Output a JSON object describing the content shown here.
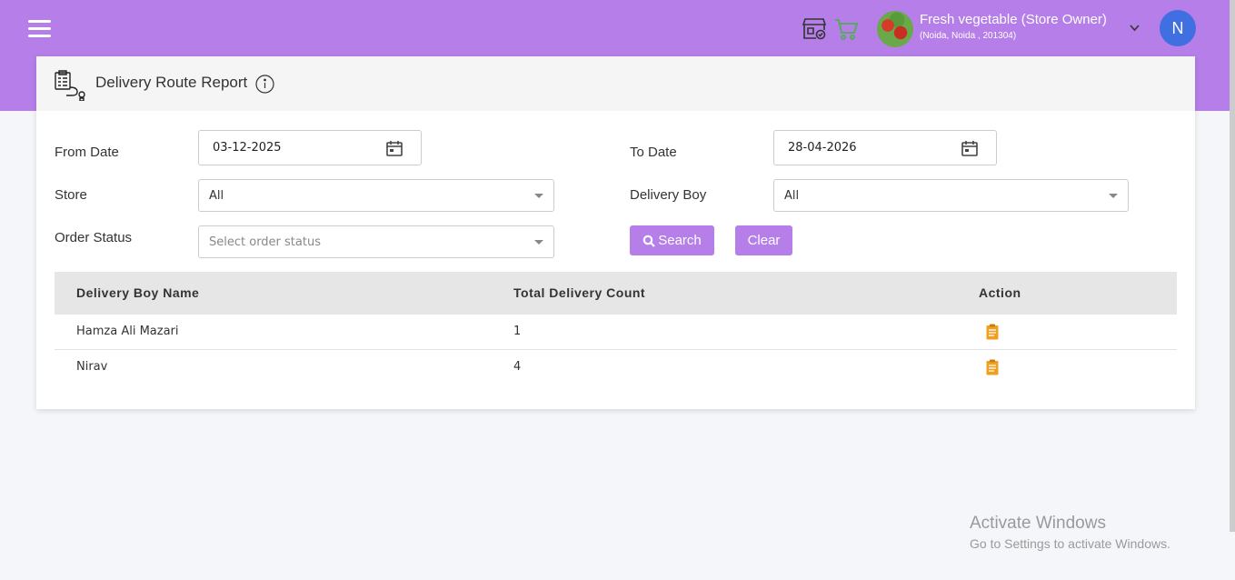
{
  "header": {
    "store_name": "Fresh vegetable (Store Owner)",
    "store_address": "(Noida, Noida , 201304)",
    "user_initial": "N",
    "icons": [
      "menu-icon",
      "store-icon",
      "cart-icon",
      "chevron-down-icon"
    ]
  },
  "report": {
    "title": "Delivery Route Report",
    "icons": [
      "report-icon",
      "info-icon"
    ]
  },
  "filters": {
    "from_date_label": "From Date",
    "from_date_value": "03-12-2025",
    "to_date_label": "To Date",
    "to_date_value": "28-04-2026",
    "store_label": "Store",
    "store_value": "All",
    "delivery_boy_label": "Delivery Boy",
    "delivery_boy_value": "All",
    "order_status_label": "Order Status",
    "order_status_placeholder": "Select order status",
    "search_label": "Search",
    "clear_label": "Clear"
  },
  "table": {
    "columns": [
      "Delivery Boy Name",
      "Total Delivery Count",
      "Action"
    ],
    "rows": [
      {
        "name": "Hamza Ali Mazari",
        "count": "1"
      },
      {
        "name": "Nirav",
        "count": "4"
      }
    ]
  },
  "watermark": {
    "line1": "Activate Windows",
    "line2": "Go to Settings to activate Windows."
  },
  "colors": {
    "accent": "#b57ee8",
    "avatar": "#3f6fe0",
    "cart": "#4caf50",
    "action_icon": "#f0a020"
  }
}
